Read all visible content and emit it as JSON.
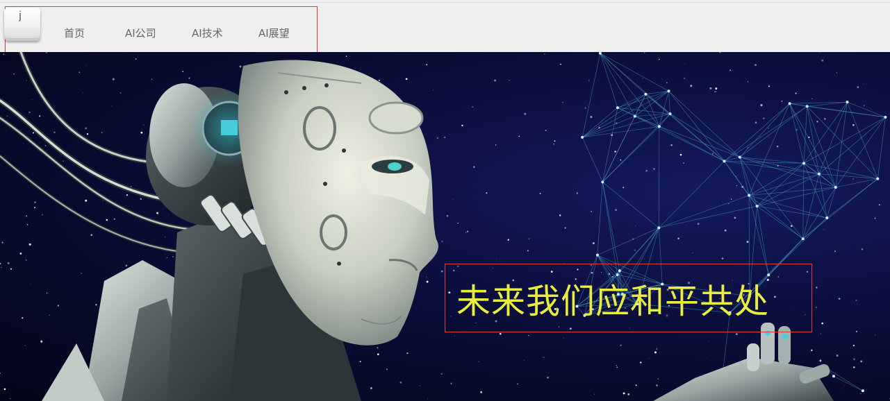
{
  "logo": {
    "letter": "j",
    "icon": "keyboard-key-j"
  },
  "nav": {
    "items": [
      {
        "label": "首页"
      },
      {
        "label": "AI公司"
      },
      {
        "label": "AI技术"
      },
      {
        "label": "AI展望"
      }
    ]
  },
  "hero": {
    "image": "robot-starfield",
    "slogan": "未来我们应和平共处"
  },
  "colors": {
    "nav_bg": "#efefef",
    "nav_text": "#666666",
    "outline": "#e4393c",
    "slogan": "#e9ee3e",
    "space": "#090c33"
  }
}
